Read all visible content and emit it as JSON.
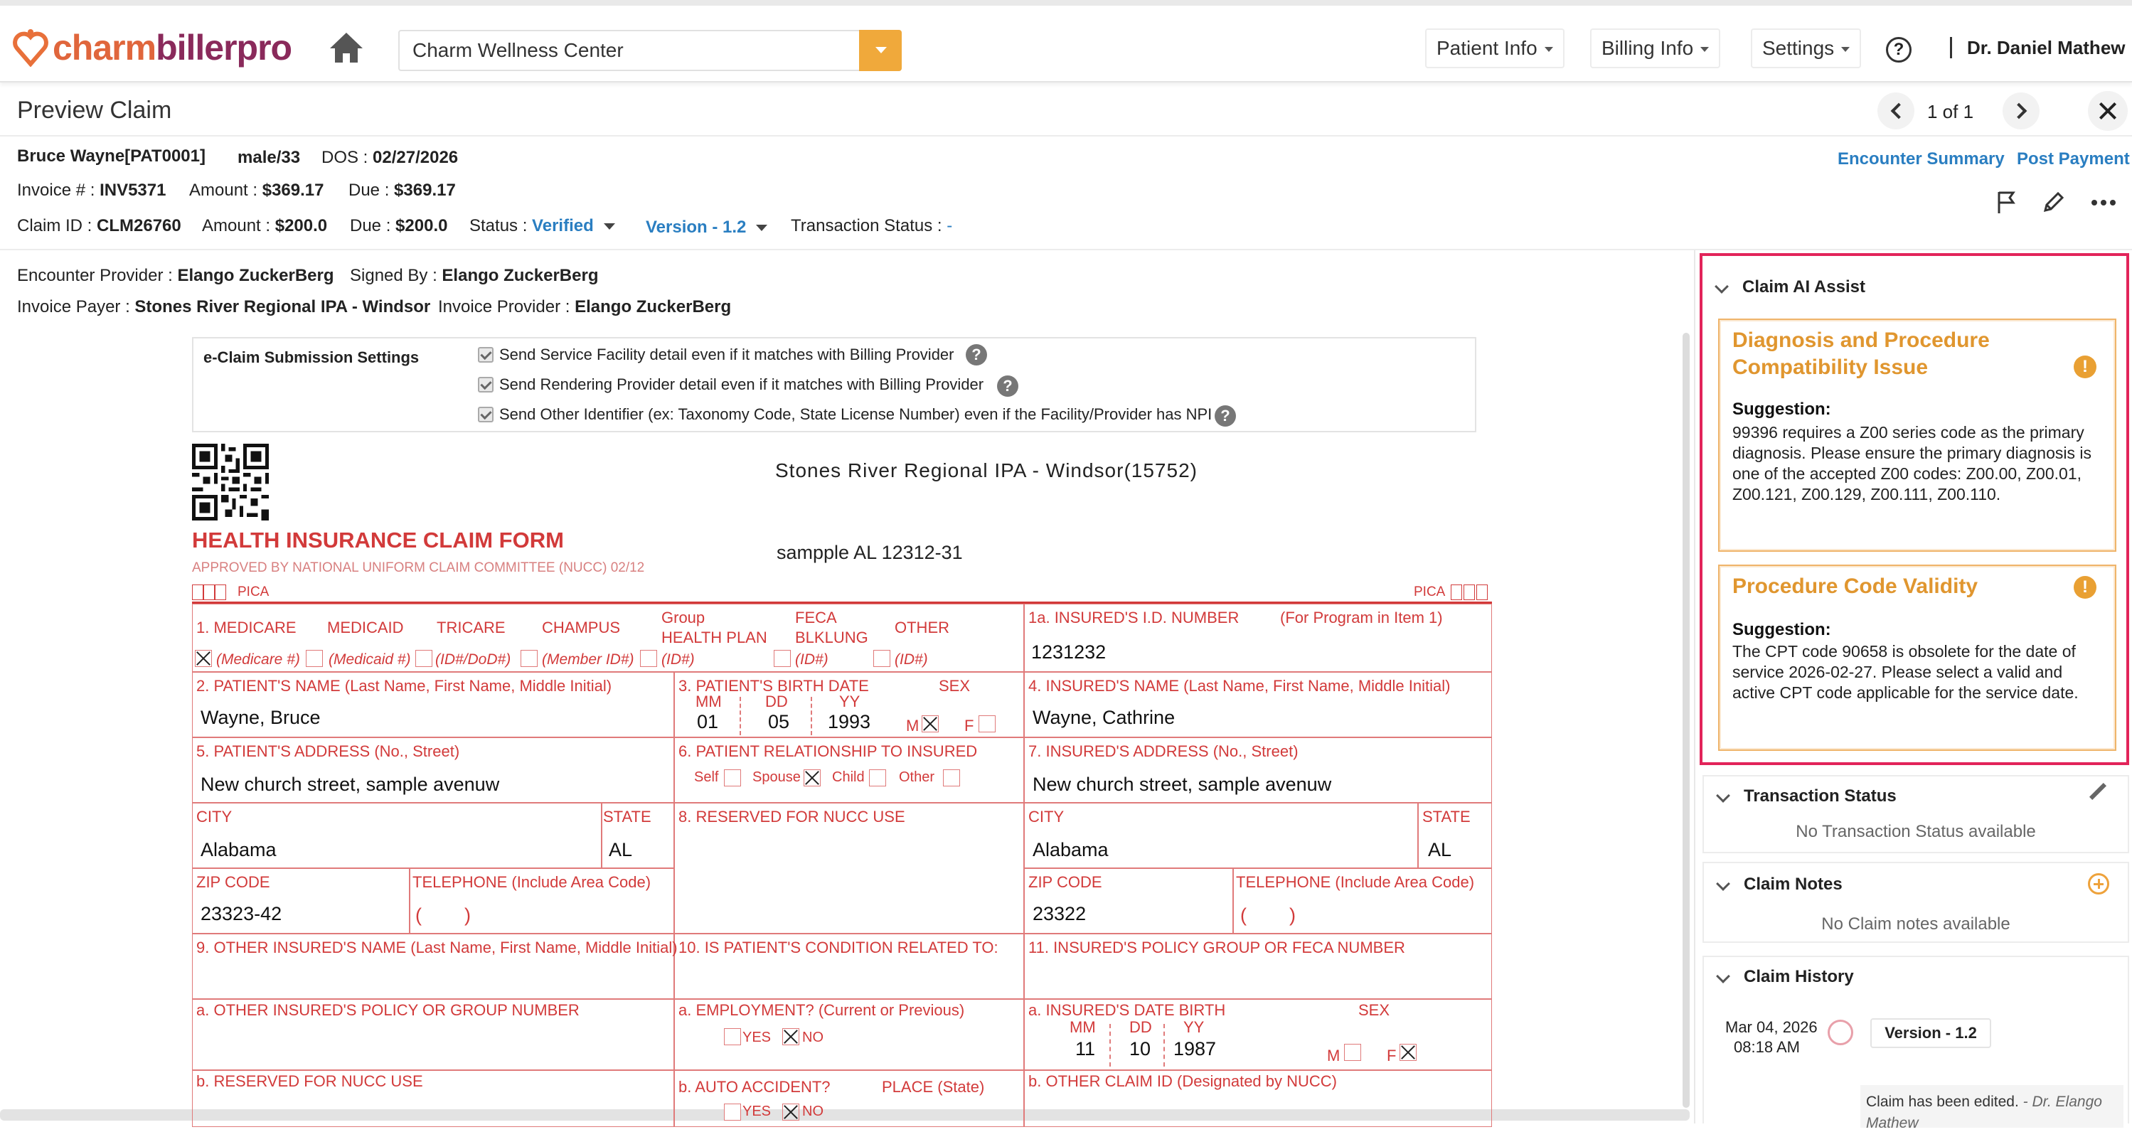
{
  "app": {
    "logo": "charmbillerpro",
    "logo_part1": "charm",
    "logo_part2": "billerpro",
    "facility": "Charm Wellness Center",
    "nav": [
      "Patient Info",
      "Billing Info",
      "Settings"
    ],
    "help": "?",
    "user": "Dr. Daniel Mathew"
  },
  "header": {
    "title": "Preview Claim",
    "pager": "1 of 1"
  },
  "patient": {
    "name": "Bruce Wayne[PAT0001]",
    "gender_age": "male/33",
    "dos_label": "DOS :",
    "dos": "02/27/2026",
    "invoice_label": "Invoice # :",
    "invoice": "INV5371",
    "amount_label": "Amount :",
    "inv_amount": "$369.17",
    "due_label": "Due :",
    "inv_due": "$369.17",
    "claim_label": "Claim ID :",
    "claim_id": "CLM26760",
    "claim_amount": "$200.0",
    "claim_due": "$200.0",
    "status_label": "Status :",
    "status": "Verified",
    "version": "Version - 1.2",
    "tx_label": "Transaction Status :",
    "tx_status": "-",
    "enc_provider_label": "Encounter Provider :",
    "enc_provider": "Elango ZuckerBerg",
    "signed_label": "Signed By :",
    "signed_by": "Elango ZuckerBerg",
    "payer_label": "Invoice Payer :",
    "payer": "Stones River Regional IPA - Windsor",
    "inv_provider_label": "Invoice Provider :",
    "inv_provider": "Elango ZuckerBerg"
  },
  "links": {
    "encounter_summary": "Encounter Summary",
    "post_payment": "Post Payment"
  },
  "ecs": {
    "title": "e-Claim Submission Settings",
    "options": [
      "Send Service Facility detail even if it matches with Billing Provider",
      "Send Rendering Provider detail even if it matches with Billing Provider",
      "Send Other Identifier (ex: Taxonomy Code, State License Number) even if the Facility/Provider has NPI"
    ]
  },
  "form": {
    "payer_name": "Stones River Regional IPA - Windsor(15752)",
    "payer_addr": "sampple AL 12312-31",
    "title": "HEALTH INSURANCE CLAIM FORM",
    "approved": "APPROVED BY NATIONAL UNIFORM CLAIM COMMITTEE (NUCC) 02/12",
    "pica": "PICA",
    "l1": {
      "medicare": "1.  MEDICARE",
      "medicaid": "MEDICAID",
      "tricare": "TRICARE",
      "champus": "CHAMPUS",
      "group": "Group",
      "health_plan": "HEALTH PLAN",
      "feca": "FECA",
      "blklung": "BLKLUNG",
      "other": "OTHER",
      "i_medicare": "(Medicare #)",
      "i_medicaid": "(Medicaid #)",
      "i_tricare": "(ID#/DoD#)",
      "i_champus": "(Member ID#)",
      "i_group": "(ID#)",
      "i_feca": "(ID#)",
      "i_other": "(ID#)"
    },
    "l1a": "1a. INSURED'S I.D. NUMBER",
    "l1a_note": "(For Program in Item 1)",
    "insured_id": "1231232",
    "l2": "2. PATIENT'S NAME (Last Name, First Name, Middle Initial)",
    "patient_name": "Wayne, Bruce",
    "l3": "3. PATIENT'S BIRTH DATE",
    "mm": "MM",
    "dd": "DD",
    "yy": "YY",
    "sex": "SEX",
    "bd_mm": "01",
    "bd_dd": "05",
    "bd_yy": "1993",
    "m": "M",
    "f": "F",
    "l4": "4. INSURED'S NAME (Last Name, First Name, Middle Initial)",
    "insured_name": "Wayne, Cathrine",
    "l5": "5. PATIENT'S ADDRESS (No., Street)",
    "patient_addr": "New church street, sample avenuw",
    "l6": "6. PATIENT RELATIONSHIP TO INSURED",
    "self": "Self",
    "spouse": "Spouse",
    "child": "Child",
    "other": "Other",
    "l7": "7. INSURED'S ADDRESS (No., Street)",
    "insured_addr": "New church street, sample avenuw",
    "city": "CITY",
    "state": "STATE",
    "p_city": "Alabama",
    "p_state": "AL",
    "i_city": "Alabama",
    "i_state": "AL",
    "l8": "8. RESERVED FOR NUCC USE",
    "zip": "ZIP CODE",
    "tel": "TELEPHONE (Include Area Code)",
    "p_zip": "23323-42",
    "i_zip": "23322",
    "tel_val": "(        )",
    "l9": "9. OTHER INSURED'S NAME (Last Name, First Name, Middle Initial)",
    "l10": "10. IS PATIENT'S CONDITION RELATED TO:",
    "l11": "11. INSURED'S POLICY GROUP OR FECA NUMBER",
    "l9a": "a. OTHER INSURED'S POLICY OR GROUP NUMBER",
    "l10a": "a. EMPLOYMENT? (Current or Previous)",
    "yes": "YES",
    "no": "NO",
    "l11a": "a. INSURED'S DATE BIRTH",
    "ib_mm": "11",
    "ib_dd": "10",
    "ib_yy": "1987",
    "l9b": "b. RESERVED FOR NUCC USE",
    "l10b": "b. AUTO ACCIDENT?",
    "place": "PLACE (State)",
    "l11b": "b. OTHER CLAIM ID (Designated by NUCC)"
  },
  "ai": {
    "title": "Claim AI Assist",
    "cards": [
      {
        "title": "Diagnosis and Procedure Compatibility Issue",
        "label": "Suggestion:",
        "text": "99396 requires a Z00 series code as the primary diagnosis. Please ensure the primary diagnosis is one of the accepted Z00 codes: Z00.00, Z00.01, Z00.121, Z00.129, Z00.111, Z00.110."
      },
      {
        "title": "Procedure Code Validity",
        "label": "Suggestion:",
        "text": "The CPT code 90658 is obsolete for the date of service 2026-02-27. Please select a valid and active CPT code applicable for the service date."
      }
    ]
  },
  "tx": {
    "title": "Transaction Status",
    "empty": "No Transaction Status available"
  },
  "notes": {
    "title": "Claim Notes",
    "empty": "No Claim notes available"
  },
  "history": {
    "title": "Claim History",
    "date": "Mar 04, 2026",
    "time": "08:18 AM",
    "version": "Version - 1.2",
    "text": "Claim has been edited.",
    "by": "- Dr. Elango",
    "by2": "Mathew"
  },
  "colors": {
    "accent": "#f0a93b",
    "link": "#2a7ec1",
    "form_red": "#d23a3a",
    "highlight": "#e2245a",
    "card_title": "#e0962f"
  }
}
